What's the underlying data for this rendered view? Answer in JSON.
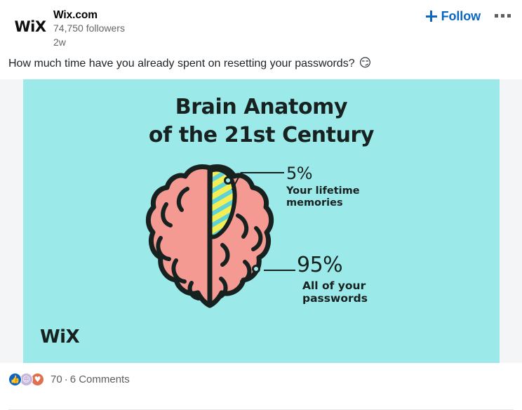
{
  "post": {
    "author": {
      "logo_text": "WiX",
      "name": "Wix.com",
      "followers": "74,750 followers",
      "timestamp": "2w"
    },
    "actions": {
      "follow_label": "Follow",
      "plus_icon": "plus-icon",
      "overflow_icon": "ellipsis-icon"
    },
    "body_text": "How much time have you already spent on resetting your passwords?",
    "body_emoji": "😏",
    "image": {
      "background_color": "#9ce9e9",
      "title_line1": "Brain Anatomy",
      "title_line2": "of the 21st Century",
      "watermark": "WiX",
      "brain_fill": "#f59a92",
      "brain_outline": "#17211f",
      "highlight_fill": "#f5ee55",
      "highlight_stripe": "#5ed3d3",
      "callouts": [
        {
          "percent": "5%",
          "desc_line1": "Your lifetime",
          "desc_line2": "memories"
        },
        {
          "percent": "95%",
          "desc_line1": "All of your",
          "desc_line2": "passwords"
        }
      ]
    },
    "social": {
      "reactions": [
        {
          "name": "like",
          "glyph": "👍",
          "color": "#0a66c2"
        },
        {
          "name": "funny",
          "glyph": "☺",
          "color": "#c8b7dd"
        },
        {
          "name": "love",
          "glyph": "♥",
          "color": "#df704d"
        }
      ],
      "reaction_count": "70",
      "separator": "·",
      "comments_label": "6 Comments"
    }
  },
  "chart_data": {
    "type": "pie",
    "title": "Brain Anatomy of the 21st Century",
    "categories": [
      "Your lifetime memories",
      "All of your passwords"
    ],
    "values": [
      5,
      95
    ],
    "unit": "%",
    "labels": [
      "5%",
      "95%"
    ],
    "colors": [
      "#f5ee55",
      "#f59a92"
    ],
    "legend": "callouts",
    "grid": false
  }
}
